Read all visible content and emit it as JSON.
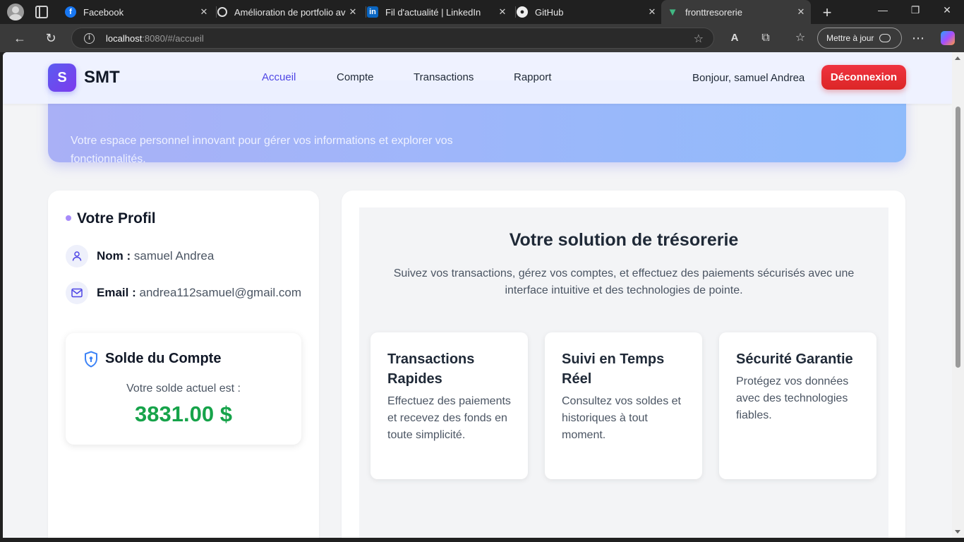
{
  "browser": {
    "tabs": [
      {
        "title": "Facebook",
        "favicon": "facebook-icon"
      },
      {
        "title": "Amélioration de portfolio av",
        "favicon": "refresh-circle-icon"
      },
      {
        "title": "Fil d'actualité | LinkedIn",
        "favicon": "linkedin-icon"
      },
      {
        "title": "GitHub",
        "favicon": "github-icon"
      },
      {
        "title": "fronttresorerie",
        "favicon": "vue-icon"
      }
    ],
    "url_host": "localhost",
    "url_path": ":8080/#/accueil",
    "update_button": "Mettre à jour"
  },
  "nav": {
    "logo_letter": "S",
    "brand": "SMT",
    "links": [
      "Accueil",
      "Compte",
      "Transactions",
      "Rapport"
    ],
    "active_link": "Accueil",
    "greeting": "Bonjour, samuel Andrea",
    "logout": "Déconnexion"
  },
  "hero": {
    "subtitle": "Votre espace personnel innovant pour gérer vos informations et explorer vos fonctionnalités."
  },
  "profile": {
    "title": "Votre Profil",
    "name_label": "Nom :",
    "name_value": "samuel Andrea",
    "email_label": "Email :",
    "email_value": "andrea112samuel@gmail.com"
  },
  "balance": {
    "title": "Solde du Compte",
    "subtitle": "Votre solde actuel est :",
    "amount": "3831.00 $"
  },
  "solution": {
    "title": "Votre solution de trésorerie",
    "description": "Suivez vos transactions, gérez vos comptes, et effectuez des paiements sécurisés avec une interface intuitive et des technologies de pointe.",
    "features": [
      {
        "title": "Transactions Rapides",
        "text": "Effectuez des paiements et recevez des fonds en toute simplicité."
      },
      {
        "title": "Suivi en Temps Réel",
        "text": "Consultez vos soldes et historiques à tout moment."
      },
      {
        "title": "Sécurité Garantie",
        "text": "Protégez vos données avec des technologies fiables."
      }
    ]
  },
  "colors": {
    "accent": "#4f46e5",
    "logout": "#dc2626",
    "balance": "#16a34a"
  }
}
